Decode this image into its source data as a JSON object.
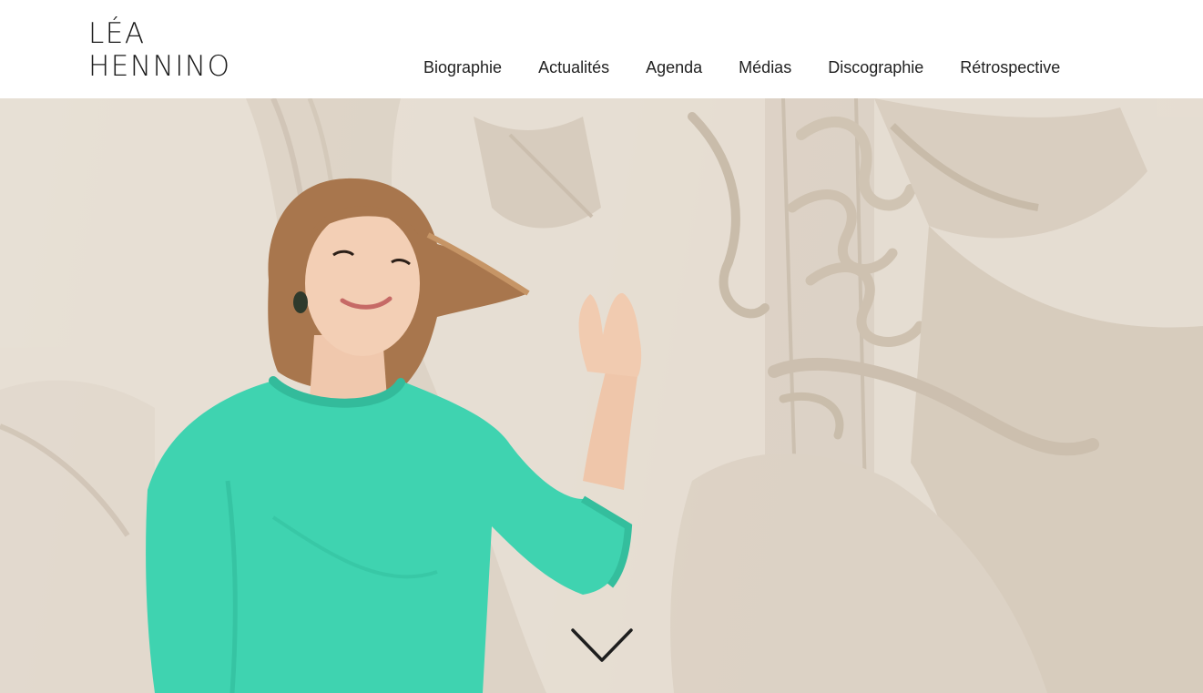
{
  "header": {
    "logo": {
      "line1": "LÉA",
      "line2": "HENNINO"
    },
    "nav": [
      {
        "label": "Biographie"
      },
      {
        "label": "Actualités"
      },
      {
        "label": "Agenda"
      },
      {
        "label": "Médias"
      },
      {
        "label": "Discographie"
      },
      {
        "label": "Rétrospective"
      }
    ]
  },
  "hero": {
    "image": "portrait-photo",
    "scroll_icon": "chevron-down-icon"
  },
  "colors": {
    "text": "#1d1d1d",
    "sweater": "#3fd3b0",
    "stone": "#e6ddd1"
  }
}
